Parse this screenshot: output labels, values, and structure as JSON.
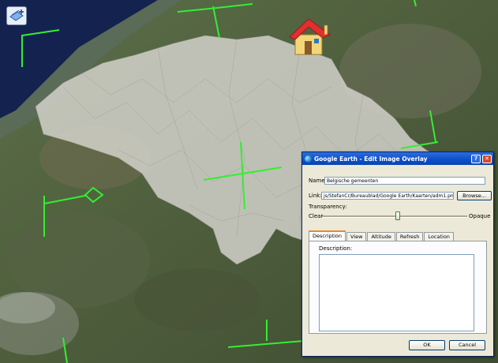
{
  "toolbar": {
    "icon": "add-image-overlay-icon"
  },
  "placemark": {
    "icon": "house-icon"
  },
  "dialog": {
    "title": "Google Earth - Edit Image Overlay",
    "help_label": "?",
    "close_label": "✕",
    "name_label": "Name:",
    "name_value": "Belgische gemeenten",
    "link_label": "Link:",
    "link_value": "js/StefanCr/Bureaublad/Google Earth/Kaarten/adm1.png",
    "browse_label": "Browse...",
    "transparency_label": "Transparency:",
    "clear_label": "Clear",
    "opaque_label": "Opaque",
    "transparency_level": 0.52,
    "tabs": [
      "Description",
      "View",
      "Altitude",
      "Refresh",
      "Location"
    ],
    "active_tab": "Description",
    "description_label": "Description:",
    "description_value": "",
    "ok_label": "OK",
    "cancel_label": "Cancel"
  },
  "colors": {
    "overlay_handles": "#33ee33",
    "titlebar": "#0a4fc9",
    "dialog_bg": "#ece9d8"
  }
}
